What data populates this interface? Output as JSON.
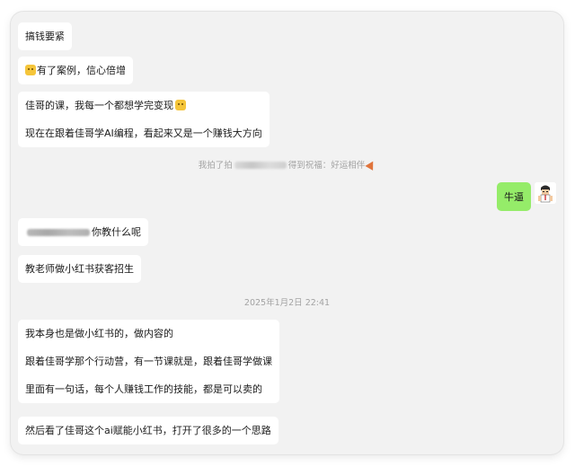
{
  "messages": {
    "m1": "搞钱要紧",
    "m2": "有了案例，信心倍增",
    "m3_line1": "佳哥的课，我每一个都想学完变现",
    "m3_line2": "现在在跟着佳哥学AI编程，看起来又是一个赚钱大方向",
    "m4": "牛逼",
    "m5": "你教什么呢",
    "m6": "教老师做小红书获客招生",
    "m7_line1": "我本身也是做小红书的，做内容的",
    "m7_line2": "跟着佳哥学那个行动营，有一节课就是，跟着佳哥学做课",
    "m7_line3": "里面有一句话，每个人赚钱工作的技能，都是可以卖的",
    "m8": "然后看了佳哥这个ai赋能小红书，打开了很多的一个思路"
  },
  "system": {
    "pat_prefix": "我拍了拍",
    "pat_suffix": "得到祝福：好运相伴",
    "timestamp": "2025年1月2日 22:41"
  },
  "icons": {
    "emoji": "cat-face-emoji",
    "party": "party-popper-icon",
    "avatar": "user-avatar-cartoon"
  },
  "colors": {
    "background": "#f2f2f2",
    "incoming_bubble": "#ffffff",
    "outgoing_bubble": "#95ec69",
    "system_text": "#a3a3a3"
  }
}
